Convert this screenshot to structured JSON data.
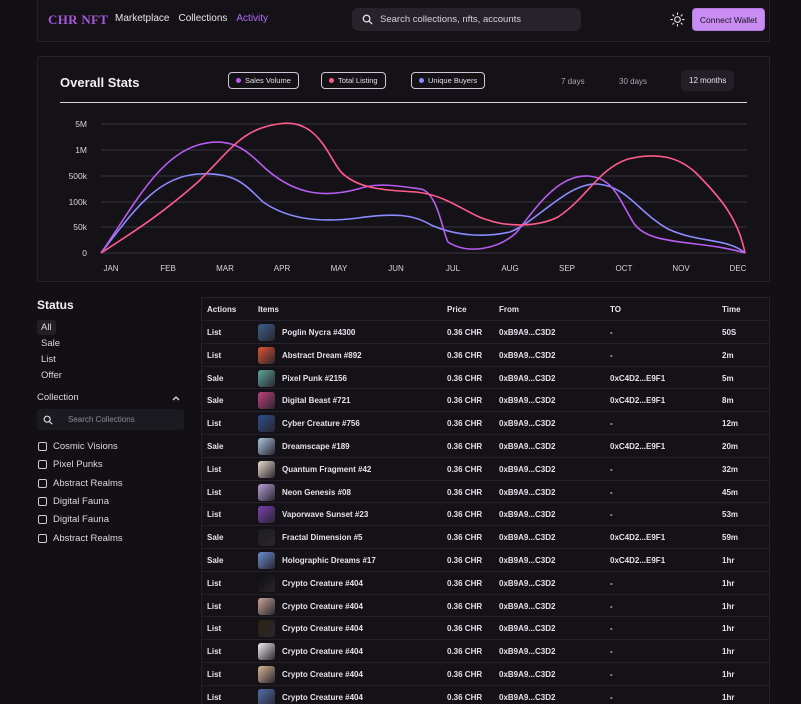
{
  "header": {
    "logo": "CHR NFT",
    "nav": [
      {
        "label": "Marketplace",
        "active": false
      },
      {
        "label": "Collections",
        "active": false
      },
      {
        "label": "Activity",
        "active": true
      }
    ],
    "search_placeholder": "Search collections, nfts, accounts",
    "connect_label": "Connect Wallet",
    "icons": {
      "search": "search-icon",
      "theme": "sun-icon"
    }
  },
  "stats": {
    "title": "Overall Stats",
    "legend": [
      {
        "label": "Sales Volume",
        "color": "#b85cf0"
      },
      {
        "label": "Total Listing",
        "color": "#ff5c8a"
      },
      {
        "label": "Unique Buyers",
        "color": "#8a8cff"
      }
    ],
    "periods": [
      "7 days",
      "30 days",
      "12 months"
    ],
    "active_period": "12 months"
  },
  "chart_data": {
    "type": "line",
    "title": "Overall Stats",
    "categories": [
      "JAN",
      "FEB",
      "MAR",
      "APR",
      "MAY",
      "JUN",
      "JUL",
      "AUG",
      "SEP",
      "OCT",
      "NOV",
      "DEC"
    ],
    "y_ticks": [
      "0",
      "50k",
      "100k",
      "500k",
      "1M",
      "5M"
    ],
    "grid": true,
    "legend_placement": "top",
    "series": [
      {
        "name": "Sales Volume",
        "color": "#b85cf0",
        "values": [
          "0",
          "500k",
          "1M",
          "500k",
          "100k",
          "100k",
          "10k",
          "50k",
          "500k",
          "500k",
          "10k",
          "0"
        ]
      },
      {
        "name": "Total Listing",
        "color": "#ff5c8a",
        "values": [
          "0",
          "100k",
          "500k",
          "5M",
          "1M",
          "100k",
          "100k",
          "50k",
          "100k",
          "500k",
          "500k",
          "0"
        ]
      },
      {
        "name": "Unique Buyers",
        "color": "#8a8cff",
        "values": [
          "0",
          "500k",
          "500k",
          "100k",
          "50k",
          "50k",
          "50k",
          "50k",
          "100k",
          "100k",
          "50k",
          "0"
        ]
      }
    ]
  },
  "filters": {
    "status_title": "Status",
    "status_options": [
      {
        "label": "All",
        "selected": true
      },
      {
        "label": "Sale",
        "selected": false
      },
      {
        "label": "List",
        "selected": false
      },
      {
        "label": "Offer",
        "selected": false
      }
    ],
    "collection_title": "Collection",
    "collection_search_placeholder": "Search Collections",
    "collections": [
      "Cosmic Visions",
      "Pixel Punks",
      "Abstract Realms",
      "Digital Fauna",
      "Digital Fauna",
      "Abstract Realms"
    ]
  },
  "activity": {
    "headers": [
      "Actions",
      "Items",
      "Price",
      "From",
      "TO",
      "Time"
    ],
    "rows": [
      {
        "action": "List",
        "item": "Poglin Nycra #4300",
        "price": "0.36 CHR",
        "from": "0xB9A9...C3D2",
        "to": "-",
        "time": "50S",
        "color": "#3b5f8a"
      },
      {
        "action": "List",
        "item": "Abstract Dream #892",
        "price": "0.36 CHR",
        "from": "0xB9A9...C3D2",
        "to": "-",
        "time": "2m",
        "color": "#e0552e"
      },
      {
        "action": "Sale",
        "item": "Pixel Punk #2156",
        "price": "0.36 CHR",
        "from": "0xB9A9...C3D2",
        "to": "0xC4D2...E9F1",
        "time": "5m",
        "color": "#5aa89a"
      },
      {
        "action": "Sale",
        "item": "Digital Beast #721",
        "price": "0.36 CHR",
        "from": "0xB9A9...C3D2",
        "to": "0xC4D2...E9F1",
        "time": "8m",
        "color": "#c2417a"
      },
      {
        "action": "List",
        "item": "Cyber Creature #756",
        "price": "0.36 CHR",
        "from": "0xB9A9...C3D2",
        "to": "-",
        "time": "12m",
        "color": "#2a4f8c"
      },
      {
        "action": "Sale",
        "item": "Dreamscape #189",
        "price": "0.36 CHR",
        "from": "0xB9A9...C3D2",
        "to": "0xC4D2...E9F1",
        "time": "20m",
        "color": "#a9c6e0"
      },
      {
        "action": "List",
        "item": "Quantum Fragment #42",
        "price": "0.36 CHR",
        "from": "0xB9A9...C3D2",
        "to": "-",
        "time": "32m",
        "color": "#e9dccb"
      },
      {
        "action": "List",
        "item": "Neon Genesis #08",
        "price": "0.36 CHR",
        "from": "0xB9A9...C3D2",
        "to": "-",
        "time": "45m",
        "color": "#b7a0d6"
      },
      {
        "action": "List",
        "item": "Vaporwave Sunset #23",
        "price": "0.36 CHR",
        "from": "0xB9A9...C3D2",
        "to": "-",
        "time": "53m",
        "color": "#7c3fb0"
      },
      {
        "action": "Sale",
        "item": "Fractal Dimension #5",
        "price": "0.36 CHR",
        "from": "0xB9A9...C3D2",
        "to": "0xC4D2...E9F1",
        "time": "59m",
        "color": "#1c1c1c"
      },
      {
        "action": "Sale",
        "item": "Holographic Dreams #17",
        "price": "0.36 CHR",
        "from": "0xB9A9...C3D2",
        "to": "0xC4D2...E9F1",
        "time": "1hr",
        "color": "#6a8ed0"
      },
      {
        "action": "List",
        "item": "Crypto Creature #404",
        "price": "0.36 CHR",
        "from": "0xB9A9...C3D2",
        "to": "-",
        "time": "1hr",
        "color": "#0d0d0d"
      },
      {
        "action": "List",
        "item": "Crypto Creature #404",
        "price": "0.36 CHR",
        "from": "0xB9A9...C3D2",
        "to": "-",
        "time": "1hr",
        "color": "#c7a596"
      },
      {
        "action": "List",
        "item": "Crypto Creature #404",
        "price": "0.36 CHR",
        "from": "0xB9A9...C3D2",
        "to": "-",
        "time": "1hr",
        "color": "#2b2410"
      },
      {
        "action": "List",
        "item": "Crypto Creature #404",
        "price": "0.36 CHR",
        "from": "0xB9A9...C3D2",
        "to": "-",
        "time": "1hr",
        "color": "#f2f0ee"
      },
      {
        "action": "List",
        "item": "Crypto Creature #404",
        "price": "0.36 CHR",
        "from": "0xB9A9...C3D2",
        "to": "-",
        "time": "1hr",
        "color": "#d9b894"
      },
      {
        "action": "List",
        "item": "Crypto Creature #404",
        "price": "0.36 CHR",
        "from": "0xB9A9...C3D2",
        "to": "-",
        "time": "1hr",
        "color": "#4f6fa8"
      }
    ]
  }
}
